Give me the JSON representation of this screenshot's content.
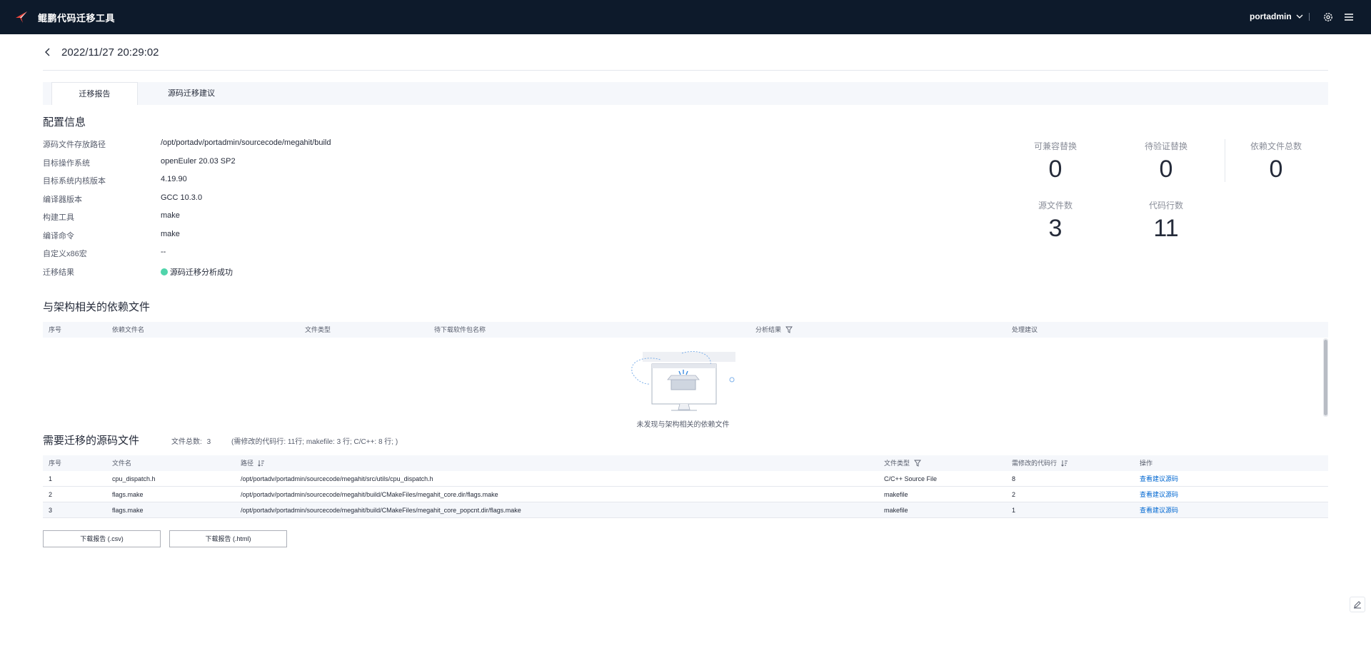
{
  "app": {
    "title": "鲲鹏代码迁移工具",
    "user": "portadmin"
  },
  "header": {
    "title": "2022/11/27 20:29:02"
  },
  "tabs": [
    {
      "label": "迁移报告",
      "active": true
    },
    {
      "label": "源码迁移建议",
      "active": false
    }
  ],
  "config": {
    "title": "配置信息",
    "items": [
      {
        "label": "源码文件存放路径",
        "value": "/opt/portadv/portadmin/sourcecode/megahit/build"
      },
      {
        "label": "目标操作系统",
        "value": "openEuler 20.03 SP2"
      },
      {
        "label": "目标系统内核版本",
        "value": "4.19.90"
      },
      {
        "label": "编译器版本",
        "value": "GCC 10.3.0"
      },
      {
        "label": "构建工具",
        "value": "make"
      },
      {
        "label": "编译命令",
        "value": "make"
      },
      {
        "label": "自定义x86宏",
        "value": "--"
      },
      {
        "label": "迁移结果",
        "value": "源码迁移分析成功"
      }
    ]
  },
  "stats": [
    {
      "label": "可兼容替换",
      "value": "0"
    },
    {
      "label": "待验证替换",
      "value": "0"
    },
    {
      "label": "依赖文件总数",
      "value": "0"
    },
    {
      "label": "源文件数",
      "value": "3"
    },
    {
      "label": "代码行数",
      "value": "11"
    }
  ],
  "deps": {
    "title": "与架构相关的依赖文件",
    "columns": [
      "序号",
      "依赖文件名",
      "文件类型",
      "待下载软件包名称",
      "分析结果",
      "处理建议"
    ],
    "empty_text": "未发现与架构相关的依赖文件"
  },
  "sources": {
    "title": "需要迁移的源码文件",
    "total_label": "文件总数:",
    "total_value": "3",
    "detail": "(需修改的代码行: 11行; makefile: 3 行; C/C++: 8 行; )",
    "columns": [
      "序号",
      "文件名",
      "路径",
      "文件类型",
      "需修改的代码行",
      "操作"
    ],
    "rows": [
      {
        "no": "1",
        "name": "cpu_dispatch.h",
        "path": "/opt/portadv/portadmin/sourcecode/megahit/src/utils/cpu_dispatch.h",
        "type": "C/C++ Source File",
        "lines": "8",
        "action": "查看建议源码"
      },
      {
        "no": "2",
        "name": "flags.make",
        "path": "/opt/portadv/portadmin/sourcecode/megahit/build/CMakeFiles/megahit_core.dir/flags.make",
        "type": "makefile",
        "lines": "2",
        "action": "查看建议源码"
      },
      {
        "no": "3",
        "name": "flags.make",
        "path": "/opt/portadv/portadmin/sourcecode/megahit/build/CMakeFiles/megahit_core_popcnt.dir/flags.make",
        "type": "makefile",
        "lines": "1",
        "action": "查看建议源码"
      }
    ]
  },
  "buttons": {
    "csv": "下载报告 (.csv)",
    "html": "下载报告 (.html)"
  },
  "colors": {
    "topbar": "#0d1a2b",
    "link": "#0067d1",
    "success": "#50d4ab"
  },
  "icons": [
    "logo-icon",
    "chevron-down-icon",
    "gear-icon",
    "menu-icon",
    "back-icon",
    "filter-icon",
    "sort-icon",
    "edit-icon"
  ]
}
